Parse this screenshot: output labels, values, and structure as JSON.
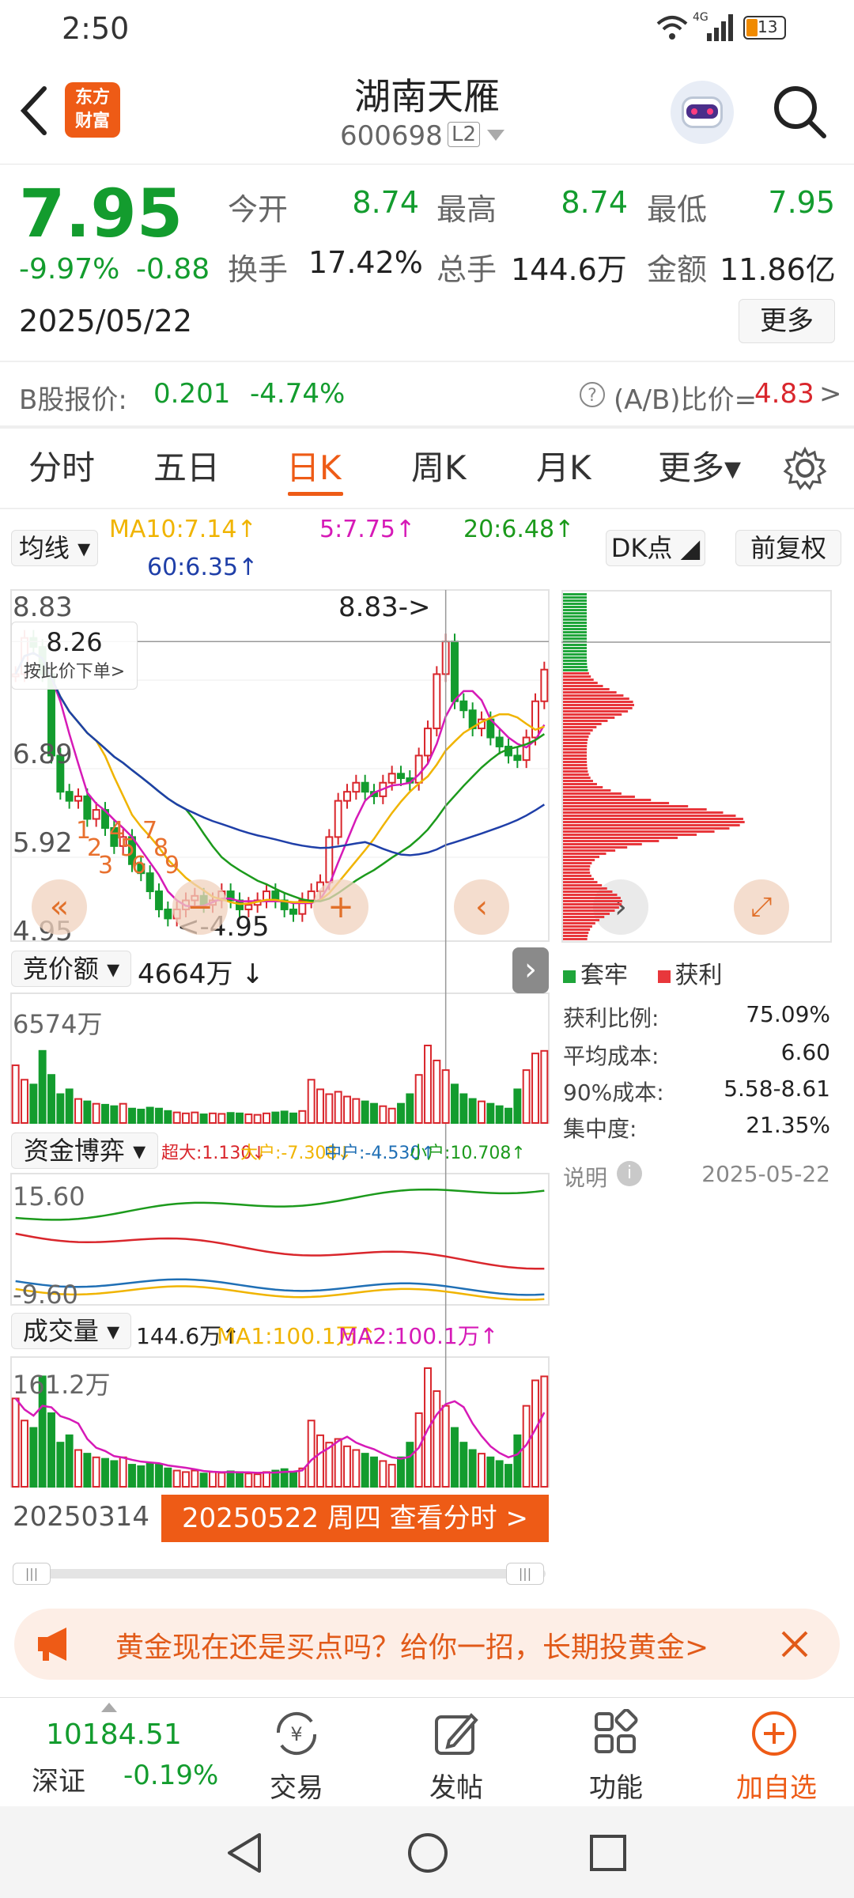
{
  "status": {
    "time": "2:50",
    "network": "4G",
    "battery": "13"
  },
  "header": {
    "logo_line1": "东方",
    "logo_line2": "财富",
    "title": "湖南天雁",
    "code": "600698",
    "level": "L2"
  },
  "quote": {
    "price": "7.95",
    "change_pct": "-9.97%",
    "change": "-0.88",
    "date": "2025/05/22",
    "open_label": "今开",
    "open": "8.74",
    "high_label": "最高",
    "high": "8.74",
    "low_label": "最低",
    "low": "7.95",
    "turnover_label": "换手",
    "turnover": "17.42%",
    "volume_label": "总手",
    "volume": "144.6万",
    "amount_label": "金额",
    "amount": "11.86亿",
    "more": "更多"
  },
  "bshare": {
    "label": "B股报价:",
    "price": "0.201",
    "pct": "-4.74%",
    "ratio_label": "(A/B)比价=",
    "ratio": "4.83",
    "arrow": ">"
  },
  "tabs": [
    "分时",
    "五日",
    "日K",
    "周K",
    "月K",
    "更多▾"
  ],
  "active_tab": 2,
  "ma_bar": {
    "dropdown": "均线",
    "ma10": "MA10:7.14↑",
    "ma5": "5:7.75↑",
    "ma20": "20:6.48↑",
    "ma60": "60:6.35↑",
    "dk": "DK点",
    "fq": "前复权"
  },
  "kline": {
    "ymax": "8.83",
    "ymid1": "6.89",
    "ymid2": "5.92",
    "ymin": "4.95",
    "high_note": "8.83->",
    "low_note": "<-4.95",
    "tooltip_price": "8.26",
    "tooltip_action": "按此价下单>",
    "markers": [
      "1",
      "2",
      "3",
      "4",
      "5",
      "6",
      "7",
      "8",
      "9"
    ]
  },
  "bidding": {
    "dropdown": "竞价额",
    "value": "4664万 ↓",
    "max": "6574万"
  },
  "capital": {
    "dropdown": "资金博弈",
    "super": "超大:1.130↓",
    "big": "大户:-7.308↓",
    "mid": "中户:-4.530↑",
    "small": "小户:10.708↑",
    "ymax": "15.60",
    "ymin": "-9.60"
  },
  "volume_panel": {
    "dropdown": "成交量",
    "value": "144.6万↑",
    "ma1": "MA1:100.1万↑",
    "ma2": "MA2:100.1万↑",
    "max": "161.2万"
  },
  "footer_dates": {
    "start": "20250314",
    "button": "20250522 周四 查看分时 >"
  },
  "chips": {
    "legend_locked": "套牢",
    "legend_profit": "获利",
    "rows": [
      {
        "label": "获利比例:",
        "value": "75.09%"
      },
      {
        "label": "平均成本:",
        "value": "6.60"
      },
      {
        "label": "90%成本:",
        "value": "5.58-8.61"
      },
      {
        "label": "集中度:",
        "value": "21.35%"
      }
    ],
    "note_label": "说明",
    "note_date": "2025-05-22"
  },
  "banner": {
    "text": "黄金现在还是买点吗？给你一招，长期投黄金>"
  },
  "bottom_nav": {
    "index_value": "10184.51",
    "index_name": "深证",
    "index_pct": "-0.19%",
    "trade": "交易",
    "post": "发帖",
    "func": "功能",
    "add": "加自选"
  },
  "colors": {
    "up": "#d9262c",
    "down": "#139c2e",
    "accent": "#ee5b16",
    "ma5": "#d61ab7",
    "ma10": "#f0b400",
    "ma20": "#1c9a1c",
    "ma60": "#1f3fa8"
  },
  "chart_data": {
    "type": "candlestick",
    "period": "20250314 - 20250522",
    "ylim": [
      4.95,
      8.83
    ],
    "close": [
      7.9,
      8.3,
      8.2,
      7.9,
      7.0,
      6.6,
      6.5,
      6.55,
      6.3,
      6.4,
      6.2,
      6.0,
      6.1,
      5.8,
      5.7,
      5.5,
      5.3,
      5.2,
      5.3,
      5.4,
      5.45,
      5.35,
      5.4,
      5.5,
      5.4,
      5.3,
      5.35,
      5.4,
      5.5,
      5.4,
      5.3,
      5.25,
      5.4,
      5.5,
      5.6,
      6.1,
      6.5,
      6.6,
      6.7,
      6.6,
      6.55,
      6.7,
      6.8,
      6.75,
      6.7,
      7.0,
      7.3,
      7.9,
      8.26,
      7.6,
      7.5,
      7.3,
      7.4,
      7.2,
      7.1,
      7.0,
      6.95,
      7.2,
      7.6,
      7.95
    ],
    "volume_wan": [
      120,
      90,
      80,
      150,
      100,
      60,
      70,
      50,
      45,
      40,
      38,
      35,
      40,
      30,
      28,
      32,
      30,
      25,
      22,
      20,
      22,
      18,
      20,
      19,
      21,
      20,
      18,
      17,
      20,
      22,
      24,
      20,
      25,
      90,
      70,
      60,
      65,
      55,
      50,
      45,
      40,
      35,
      30,
      40,
      60,
      100,
      161.2,
      130,
      110,
      80,
      60,
      50,
      45,
      40,
      35,
      30,
      70,
      110,
      144.6,
      150
    ]
  }
}
